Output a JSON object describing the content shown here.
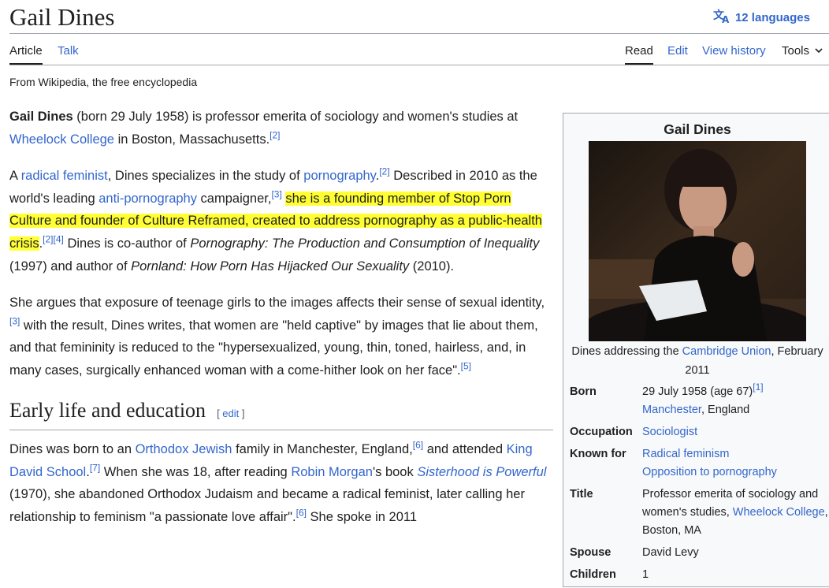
{
  "page": {
    "title": "Gail Dines",
    "languages": "12 languages",
    "tabs": {
      "article": "Article",
      "talk": "Talk",
      "read": "Read",
      "edit": "Edit",
      "history": "View history",
      "tools": "Tools"
    },
    "tagline": "From Wikipedia, the free encyclopedia"
  },
  "p1": {
    "name": "Gail Dines",
    "t1": " (born 29 July 1958) is professor emerita of sociology and women's studies at ",
    "link1": "Wheelock College",
    "t2": " in Boston, Massachusetts.",
    "ref1": "[2]"
  },
  "p2": {
    "t1": "A ",
    "link1": "radical feminist",
    "t2": ", Dines specializes in the study of ",
    "link2": "pornography",
    "t3": ".",
    "ref1": "[2]",
    "t4": " Described in 2010 as the world's leading ",
    "link3": "anti-pornography",
    "t5": " campaigner,",
    "ref2": "[3]",
    "t6": " ",
    "hl": "she is a founding member of Stop Porn Culture and founder of Culture Reframed, created to address pornography as a public-health crisis",
    "t7": ".",
    "ref3": "[2]",
    "ref4": "[4]",
    "t8": " Dines is co-author of ",
    "book1": "Pornography: The Production and Consumption of Inequality",
    "t9": " (1997) and author of ",
    "book2": "Pornland: How Porn Has Hijacked Our Sexuality",
    "t10": " (2010)."
  },
  "p3": {
    "t1": "She argues that exposure of teenage girls to the images affects their sense of sexual identity,",
    "ref1": "[3]",
    "t2": " with the result, Dines writes, that women are \"held captive\" by images that lie about them, and that femininity is reduced to the \"hypersexualized, young, thin, toned, hairless, and, in many cases, surgically enhanced woman with a come-hither look on her face\".",
    "ref2": "[5]"
  },
  "section1": {
    "title": "Early life and education",
    "edit_open": "[ ",
    "edit": "edit",
    "edit_close": " ]"
  },
  "p4": {
    "t1": "Dines was born to an ",
    "link1": "Orthodox Jewish",
    "t2": " family in Manchester, England,",
    "ref1": "[6]",
    "t3": " and attended ",
    "link2": "King David School",
    "t4": ".",
    "ref2": "[7]",
    "t5": " When she was 18, after reading ",
    "link3": "Robin Morgan",
    "t6": "'s book ",
    "link4": "Sisterhood is Powerful",
    "t7": " (1970), she abandoned Orthodox Judaism and became a radical feminist, later calling her relationship to feminism \"a passionate love affair\".",
    "ref3": "[6]",
    "t8": " She spoke in 2011"
  },
  "infobox": {
    "title": "Gail Dines",
    "caption_t1": "Dines addressing the ",
    "caption_link": "Cambridge Union",
    "caption_t2": ", February 2011",
    "born_label": "Born",
    "born_line1": "29 July 1958 (age 67)",
    "born_ref": "[1]",
    "born_link": "Manchester",
    "born_rest": ", England",
    "occupation_label": "Occupation",
    "occupation": "Sociologist",
    "known_label": "Known for",
    "known1": "Radical feminism",
    "known2": "Opposition to pornography",
    "title_label": "Title",
    "title_t1": "Professor emerita of sociology and women's studies, ",
    "title_link": "Wheelock College",
    "title_t2": ", Boston, MA",
    "spouse_label": "Spouse",
    "spouse": "David Levy",
    "children_label": "Children",
    "children": "1"
  }
}
